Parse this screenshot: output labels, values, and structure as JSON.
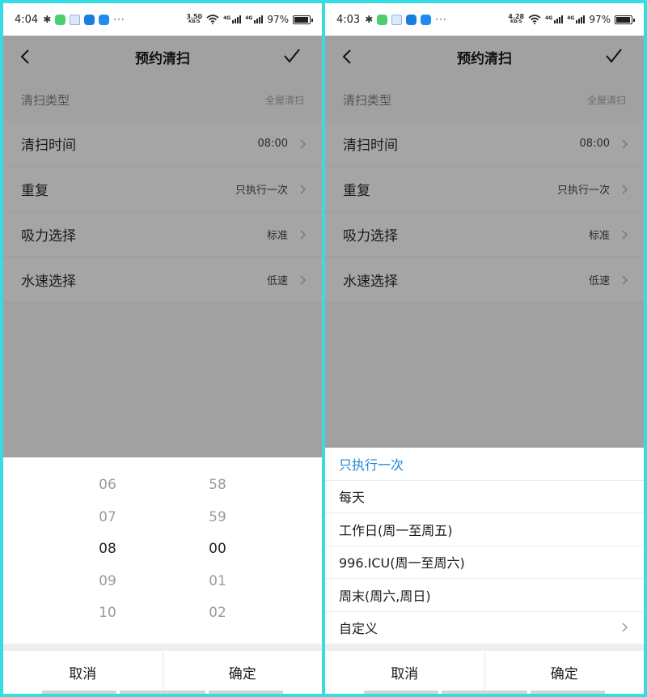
{
  "left": {
    "status": {
      "time": "4:04",
      "speed_value": "3.50",
      "speed_unit": "KB/S",
      "signal_label": "4G",
      "battery": "97%"
    },
    "header": {
      "title": "预约清扫"
    },
    "rows": {
      "type": {
        "label": "清扫类型",
        "value": "全屋清扫"
      },
      "items": [
        {
          "label": "清扫时间",
          "value": "08:00"
        },
        {
          "label": "重复",
          "value": "只执行一次"
        },
        {
          "label": "吸力选择",
          "value": "标准"
        },
        {
          "label": "水速选择",
          "value": "低速"
        }
      ]
    },
    "picker": {
      "hours": [
        "06",
        "07",
        "08",
        "09",
        "10"
      ],
      "minutes": [
        "58",
        "59",
        "00",
        "01",
        "02"
      ],
      "selected_hour": "08",
      "selected_minute": "00"
    },
    "actions": {
      "cancel": "取消",
      "confirm": "确定"
    }
  },
  "right": {
    "status": {
      "time": "4:03",
      "speed_value": "4.28",
      "speed_unit": "KB/S",
      "signal_label": "4G",
      "battery": "97%"
    },
    "header": {
      "title": "预约清扫"
    },
    "rows": {
      "type": {
        "label": "清扫类型",
        "value": "全屋清扫"
      },
      "items": [
        {
          "label": "清扫时间",
          "value": "08:00"
        },
        {
          "label": "重复",
          "value": "只执行一次"
        },
        {
          "label": "吸力选择",
          "value": "标准"
        },
        {
          "label": "水速选择",
          "value": "低速"
        }
      ]
    },
    "repeat_options": [
      "只执行一次",
      "每天",
      "工作日(周一至周五)",
      "996.ICU(周一至周六)",
      "周末(周六,周日)",
      "自定义"
    ],
    "repeat_selected": "只执行一次",
    "actions": {
      "cancel": "取消",
      "confirm": "确定"
    }
  },
  "colors": {
    "accent": "#1d86d6",
    "dim_overlay": "#a1a1a1",
    "frame": "#35dde3"
  },
  "icons": [
    "bluetooth-icon",
    "wifi-icon",
    "signal-icon",
    "battery-icon",
    "back-arrow-icon",
    "checkmark-icon",
    "chevron-right-icon"
  ]
}
